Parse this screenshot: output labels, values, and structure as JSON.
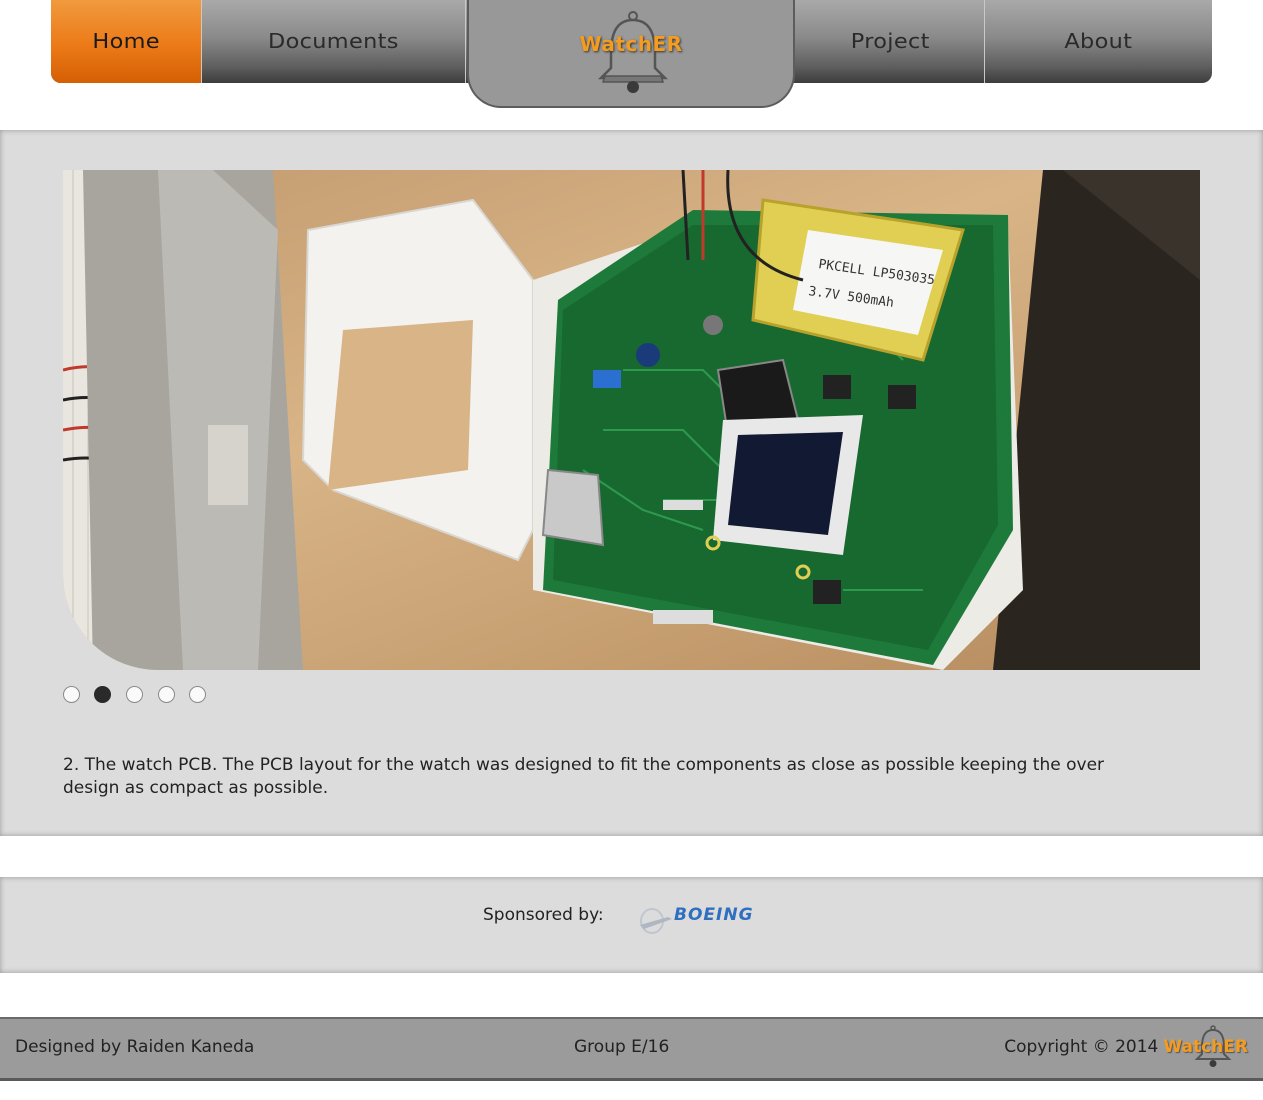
{
  "nav": {
    "items": [
      {
        "label": "Home",
        "active": true
      },
      {
        "label": "Documents"
      },
      {
        "label": "Project"
      },
      {
        "label": "About"
      }
    ],
    "logo_text": "WatchER",
    "logo_icon": "bell-icon"
  },
  "slideshow": {
    "current_slide": 2,
    "total_slides": 5,
    "image_labels": {
      "battery_line1": "PKCELL LP503035",
      "battery_line2": "3.7V 500mAh"
    },
    "caption": "2. The watch PCB. The PCB layout for the watch was designed to fit the components as close as possible keeping the over design as compact as possible."
  },
  "sponsor": {
    "label": "Sponsored by:",
    "logo_text": "BOEING"
  },
  "footer": {
    "designer": "Designed by Raiden Kaneda",
    "group": "Group E/16",
    "copyright": "Copyright © 2014",
    "brand": "WatchER"
  },
  "colors": {
    "accent_orange": "#ec7a18",
    "logo_orange": "#f39c1f",
    "panel_gray": "#dcdcdc",
    "boeing_blue": "#2f6fc0"
  }
}
